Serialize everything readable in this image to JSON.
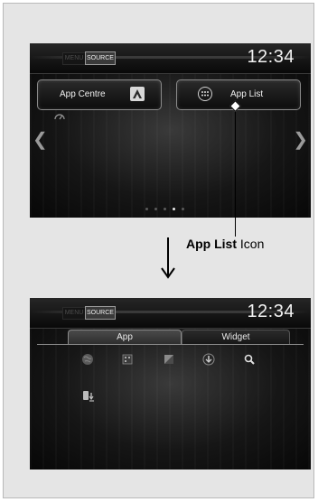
{
  "screen1": {
    "menu_label": "MENU",
    "source_label": "SOURCE",
    "clock": "12:34",
    "app_centre_label": "App Centre",
    "app_list_label": "App List",
    "app_centre_icon": "android-auto-icon",
    "app_list_icon": "app-list-icon",
    "page_count": 5,
    "active_page": 4
  },
  "callout": {
    "bold": "App List",
    "rest": " Icon"
  },
  "screen2": {
    "menu_label": "MENU",
    "source_label": "SOURCE",
    "clock": "12:34",
    "tabs": [
      {
        "label": "App",
        "active": true
      },
      {
        "label": "Widget",
        "active": false
      }
    ],
    "icons": [
      "globe-icon",
      "notepad-icon",
      "picture-icon",
      "download-icon",
      "search-icon",
      "install-app-icon"
    ]
  }
}
